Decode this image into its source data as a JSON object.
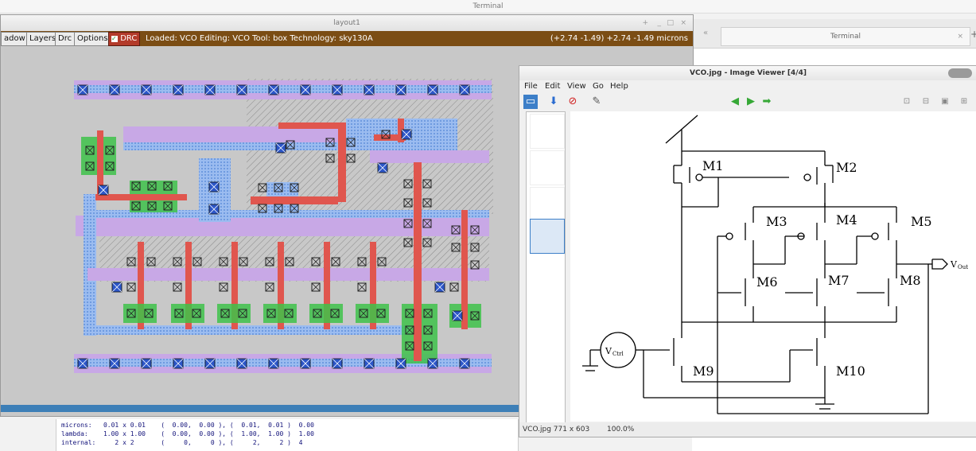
{
  "desktop": {
    "terminal_title": "Terminal"
  },
  "terminal2": {
    "tab_label": "Terminal",
    "tab_close": "×",
    "add_tab": "+",
    "scroll_left": "«"
  },
  "magic": {
    "window_title": "layout1",
    "window_controls": [
      "+",
      "_",
      "□",
      "×"
    ],
    "buttons": [
      "adow",
      "Layers",
      "Drc",
      "Options",
      "DRC"
    ],
    "drc_checked": true,
    "status_text": "Loaded: VCO  Editing: VCO  Tool: box  Technology: sky130A",
    "coords_text": "(+2.74 -1.49) +2.74 -1.49 microns"
  },
  "console": {
    "lines": [
      "microns:   0.01 x 0.01    (  0.00,  0.00 ), (  0.01,  0.01 )  0.00",
      "lambda:    1.00 x 1.00    (  0.00,  0.00 ), (  1.00,  1.00 )  1.00",
      "internal:     2 x 2       (     0,     0 ), (     2,     2 )  4"
    ]
  },
  "viewer": {
    "title": "VCO.jpg - Image Viewer [4/4]",
    "menu": [
      "File",
      "Edit",
      "View",
      "Go",
      "Help"
    ],
    "status_file": "VCO.jpg   771 x 603",
    "zoom": "100.0%",
    "schematic_labels": {
      "transistors": [
        "M1",
        "M2",
        "M3",
        "M4",
        "M5",
        "M6",
        "M7",
        "M8",
        "M9",
        "M10"
      ],
      "vctrl": "V",
      "vctrl_sub": "Ctrl",
      "vout": "V",
      "vout_sub": "Out"
    }
  },
  "colors": {
    "toolbar_brown": "#7b4d14",
    "poly_red": "#e0564e",
    "diff_green": "#3ec24a",
    "metal_purple": "#c8a8e6",
    "metal1_blue": "#8fb6ee",
    "bottom_bar_blue": "#3d7fb7"
  }
}
